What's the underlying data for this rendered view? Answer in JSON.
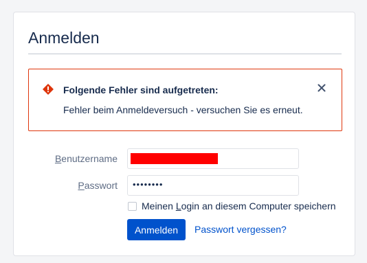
{
  "login": {
    "title": "Anmelden",
    "error": {
      "title": "Folgende Fehler sind aufgetreten:",
      "message": "Fehler beim Anmeldeversuch - versuchen Sie es erneut.",
      "icon": "error-icon",
      "close_icon": "close-icon",
      "border_color": "#de350b"
    },
    "username": {
      "label_accel": "B",
      "label_rest": "enutzername",
      "value_redacted": true
    },
    "password": {
      "label_accel": "P",
      "label_rest": "asswort",
      "masked_value": "••••••••"
    },
    "remember": {
      "label_before": "Meinen ",
      "label_accel": "L",
      "label_after": "ogin an diesem Computer speichern",
      "checked": false
    },
    "submit_label": "Anmelden",
    "forgot_label": "Passwort vergessen?",
    "accent_color": "#0052cc"
  }
}
